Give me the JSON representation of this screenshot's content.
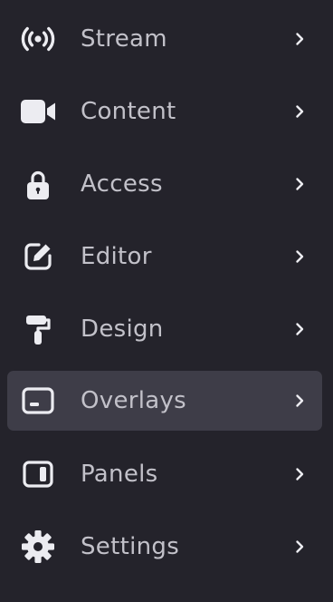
{
  "colors": {
    "background": "#24232b",
    "active_background": "#3e3d48",
    "text": "#c2c1c9",
    "icon": "#ececf1"
  },
  "menu": {
    "active_item": "overlays",
    "items": [
      {
        "id": "stream",
        "label": "Stream",
        "icon": "broadcast-icon"
      },
      {
        "id": "content",
        "label": "Content",
        "icon": "video-camera-icon"
      },
      {
        "id": "access",
        "label": "Access",
        "icon": "lock-icon"
      },
      {
        "id": "editor",
        "label": "Editor",
        "icon": "edit-pencil-icon"
      },
      {
        "id": "design",
        "label": "Design",
        "icon": "paint-roller-icon"
      },
      {
        "id": "overlays",
        "label": "Overlays",
        "icon": "overlay-icon"
      },
      {
        "id": "panels",
        "label": "Panels",
        "icon": "panel-icon"
      },
      {
        "id": "settings",
        "label": "Settings",
        "icon": "gear-icon"
      }
    ],
    "chevron_icon": "chevron-right-icon"
  }
}
